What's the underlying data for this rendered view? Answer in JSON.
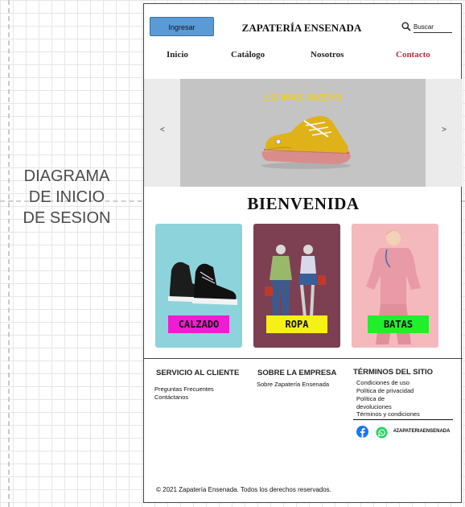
{
  "canvas": {
    "label": "DIAGRAMA\nDE INICIO\nDE SESION"
  },
  "header": {
    "login_label": "Ingresar",
    "title": "ZAPATERÍA ENSENADA",
    "search_placeholder": "Buscar"
  },
  "nav": {
    "items": [
      {
        "label": "Inicio"
      },
      {
        "label": "Catálogo"
      },
      {
        "label": "Nosotros"
      },
      {
        "label": "Contacto",
        "active": true
      }
    ]
  },
  "carousel": {
    "caption": "LO MAS NUEVO",
    "prev": "<",
    "next": ">"
  },
  "welcome": "BIENVENIDA",
  "categories": [
    {
      "label": "CALZADO",
      "bg": "#8dd3db",
      "badge": "#f01bd2"
    },
    {
      "label": "ROPA",
      "bg": "#7d3f52",
      "badge": "#f5f114"
    },
    {
      "label": "BATAS",
      "bg": "#f4b9bd",
      "badge": "#21ee2c"
    }
  ],
  "footer": {
    "customer_service": {
      "title": "SERVICIO AL CLIENTE",
      "links": [
        "Preguntas Frecuentes",
        "Contáctanos"
      ]
    },
    "company": {
      "title": "SOBRE LA EMPRESA",
      "links": [
        "Sobre Zapatería Ensenada"
      ]
    },
    "terms": {
      "title": "TÉRMINOS DEL SITIO",
      "links": [
        "Condiciones de uso",
        "Política de privacidad",
        "Política de",
        "devoluciones",
        "Términos y condiciones"
      ]
    },
    "hashtag": "#ZAPATERIAENSENADA",
    "copyright": "© 2021 Zapatería Ensenada. Todos los derechos reservados."
  },
  "colors": {
    "accent_nav": "#b3353f",
    "login_button": "#5b9bd5",
    "facebook": "#1877f2",
    "whatsapp": "#25d366"
  },
  "icons": {
    "search": "search-icon",
    "facebook": "facebook-icon",
    "whatsapp": "whatsapp-icon"
  }
}
